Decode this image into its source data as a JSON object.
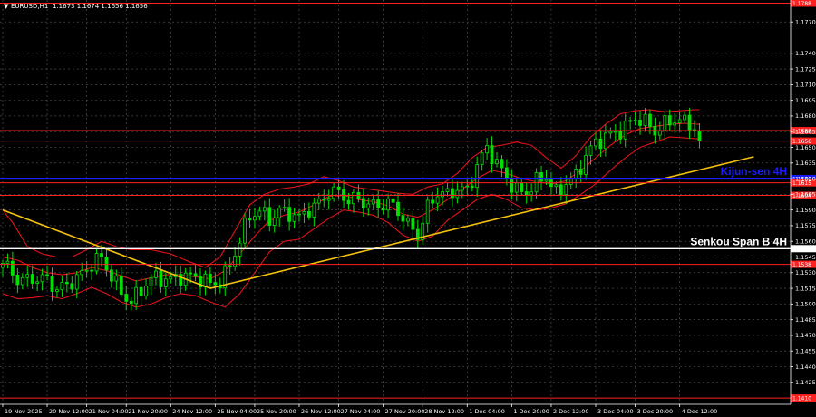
{
  "header": {
    "triangle_glyph": "▼",
    "symbol": "EURUSD,H1",
    "ohlc": "1.1673 1.1674 1.1656 1.1656"
  },
  "chart_data": {
    "type": "candlestick",
    "symbol": "EURUSD",
    "timeframe": "H1",
    "ylim": [
      1.1404,
      1.1791
    ],
    "bars_visible": 240,
    "y_ticks": [
      "1.1770",
      "1.1740",
      "1.1725",
      "1.1710",
      "1.1695",
      "1.1680",
      "1.1665",
      "1.1650",
      "1.1635",
      "1.1620",
      "1.1605",
      "1.1590",
      "1.1575",
      "1.1560",
      "1.1545",
      "1.1530",
      "1.1515",
      "1.1500",
      "1.1485",
      "1.1470",
      "1.1455",
      "1.1440",
      "1.1425"
    ],
    "x_labels": [
      {
        "text": "19 Nov 2025",
        "bar": 0
      },
      {
        "text": "20 Nov 12:00",
        "bar": 9
      },
      {
        "text": "21 Nov 04:00",
        "bar": 17
      },
      {
        "text": "21 Nov 20:00",
        "bar": 25
      },
      {
        "text": "24 Nov 12:00",
        "bar": 34
      },
      {
        "text": "25 Nov 04:00",
        "bar": 43
      },
      {
        "text": "25 Nov 20:00",
        "bar": 51
      },
      {
        "text": "26 Nov 12:00",
        "bar": 60
      },
      {
        "text": "27 Nov 04:00",
        "bar": 68
      },
      {
        "text": "27 Nov 20:00",
        "bar": 77
      },
      {
        "text": "28 Nov 12:00",
        "bar": 85
      },
      {
        "text": "1 Dec 04:00",
        "bar": 94
      },
      {
        "text": "1 Dec 20:00",
        "bar": 103
      },
      {
        "text": "2 Dec 12:00",
        "bar": 111
      },
      {
        "text": "3 Dec 04:00",
        "bar": 120
      },
      {
        "text": "3 Dec 20:00",
        "bar": 128
      },
      {
        "text": "4 Dec 12:00",
        "bar": 137
      }
    ],
    "close_path": [
      [
        0,
        1.1535
      ],
      [
        3,
        1.1525
      ],
      [
        6,
        1.1528
      ],
      [
        9,
        1.152
      ],
      [
        11,
        1.151
      ],
      [
        14,
        1.1525
      ],
      [
        17,
        1.1535
      ],
      [
        20,
        1.154
      ],
      [
        22,
        1.1525
      ],
      [
        24,
        1.1515
      ],
      [
        26,
        1.1505
      ],
      [
        28,
        1.1512
      ],
      [
        30,
        1.152
      ],
      [
        33,
        1.1525
      ],
      [
        36,
        1.153
      ],
      [
        39,
        1.1522
      ],
      [
        42,
        1.1518
      ],
      [
        44,
        1.1525
      ],
      [
        46,
        1.154
      ],
      [
        48,
        1.156
      ],
      [
        50,
        1.158
      ],
      [
        52,
        1.1588
      ],
      [
        54,
        1.1585
      ],
      [
        56,
        1.1592
      ],
      [
        58,
        1.1585
      ],
      [
        60,
        1.1578
      ],
      [
        62,
        1.159
      ],
      [
        64,
        1.16
      ],
      [
        66,
        1.161
      ],
      [
        68,
        1.1605
      ],
      [
        70,
        1.1595
      ],
      [
        72,
        1.16
      ],
      [
        75,
        1.1598
      ],
      [
        78,
        1.1595
      ],
      [
        80,
        1.1585
      ],
      [
        82,
        1.1575
      ],
      [
        84,
        1.157
      ],
      [
        86,
        1.1595
      ],
      [
        88,
        1.1605
      ],
      [
        90,
        1.16
      ],
      [
        92,
        1.161
      ],
      [
        94,
        1.1612
      ],
      [
        96,
        1.1635
      ],
      [
        98,
        1.1648
      ],
      [
        100,
        1.163
      ],
      [
        102,
        1.162
      ],
      [
        104,
        1.1612
      ],
      [
        106,
        1.161
      ],
      [
        108,
        1.1615
      ],
      [
        110,
        1.1618
      ],
      [
        112,
        1.1605
      ],
      [
        114,
        1.162
      ],
      [
        116,
        1.1625
      ],
      [
        118,
        1.164
      ],
      [
        120,
        1.165
      ],
      [
        122,
        1.166
      ],
      [
        124,
        1.1668
      ],
      [
        126,
        1.1672
      ],
      [
        128,
        1.1676
      ],
      [
        130,
        1.167
      ],
      [
        132,
        1.1665
      ],
      [
        134,
        1.1676
      ],
      [
        136,
        1.168
      ],
      [
        138,
        1.1672
      ],
      [
        140,
        1.1665
      ],
      [
        141,
        1.1656
      ]
    ],
    "band_upper": [
      [
        0,
        1.159
      ],
      [
        2,
        1.1578
      ],
      [
        5,
        1.1555
      ],
      [
        8,
        1.1548
      ],
      [
        11,
        1.1545
      ],
      [
        14,
        1.1545
      ],
      [
        17,
        1.1552
      ],
      [
        20,
        1.156
      ],
      [
        23,
        1.1555
      ],
      [
        26,
        1.1552
      ],
      [
        30,
        1.1552
      ],
      [
        34,
        1.1548
      ],
      [
        38,
        1.154
      ],
      [
        41,
        1.1535
      ],
      [
        44,
        1.1545
      ],
      [
        47,
        1.157
      ],
      [
        50,
        1.1595
      ],
      [
        53,
        1.1605
      ],
      [
        56,
        1.161
      ],
      [
        59,
        1.1612
      ],
      [
        62,
        1.1615
      ],
      [
        65,
        1.1622
      ],
      [
        68,
        1.1618
      ],
      [
        71,
        1.1612
      ],
      [
        74,
        1.161
      ],
      [
        77,
        1.1608
      ],
      [
        80,
        1.1606
      ],
      [
        83,
        1.1605
      ],
      [
        86,
        1.1612
      ],
      [
        89,
        1.1615
      ],
      [
        92,
        1.1625
      ],
      [
        95,
        1.164
      ],
      [
        98,
        1.165
      ],
      [
        101,
        1.1652
      ],
      [
        104,
        1.1655
      ],
      [
        107,
        1.1652
      ],
      [
        110,
        1.164
      ],
      [
        113,
        1.163
      ],
      [
        116,
        1.1642
      ],
      [
        119,
        1.166
      ],
      [
        122,
        1.1672
      ],
      [
        125,
        1.1682
      ],
      [
        128,
        1.1685
      ],
      [
        131,
        1.1686
      ],
      [
        134,
        1.1684
      ],
      [
        137,
        1.1685
      ],
      [
        140,
        1.1686
      ],
      [
        141,
        1.1686
      ]
    ],
    "band_middle": [
      [
        0,
        1.1545
      ],
      [
        3,
        1.1542
      ],
      [
        6,
        1.1535
      ],
      [
        9,
        1.153
      ],
      [
        12,
        1.1528
      ],
      [
        15,
        1.153
      ],
      [
        18,
        1.1535
      ],
      [
        21,
        1.1532
      ],
      [
        24,
        1.1527
      ],
      [
        27,
        1.1522
      ],
      [
        30,
        1.1525
      ],
      [
        33,
        1.1528
      ],
      [
        36,
        1.1528
      ],
      [
        39,
        1.1526
      ],
      [
        42,
        1.1524
      ],
      [
        45,
        1.1532
      ],
      [
        48,
        1.1548
      ],
      [
        51,
        1.1565
      ],
      [
        54,
        1.158
      ],
      [
        57,
        1.1585
      ],
      [
        60,
        1.1588
      ],
      [
        63,
        1.1595
      ],
      [
        66,
        1.1603
      ],
      [
        69,
        1.1604
      ],
      [
        72,
        1.16
      ],
      [
        75,
        1.1598
      ],
      [
        78,
        1.1594
      ],
      [
        81,
        1.1586
      ],
      [
        84,
        1.1583
      ],
      [
        87,
        1.159
      ],
      [
        90,
        1.16
      ],
      [
        93,
        1.161
      ],
      [
        96,
        1.162
      ],
      [
        99,
        1.1628
      ],
      [
        102,
        1.1625
      ],
      [
        105,
        1.162
      ],
      [
        108,
        1.1617
      ],
      [
        111,
        1.1615
      ],
      [
        114,
        1.1618
      ],
      [
        117,
        1.1628
      ],
      [
        120,
        1.164
      ],
      [
        123,
        1.1652
      ],
      [
        126,
        1.1662
      ],
      [
        129,
        1.1668
      ],
      [
        132,
        1.167
      ],
      [
        135,
        1.1672
      ],
      [
        138,
        1.1673
      ],
      [
        141,
        1.1672
      ]
    ],
    "band_lower": [
      [
        0,
        1.151
      ],
      [
        3,
        1.1505
      ],
      [
        6,
        1.1506
      ],
      [
        9,
        1.1508
      ],
      [
        12,
        1.1505
      ],
      [
        15,
        1.151
      ],
      [
        18,
        1.1516
      ],
      [
        21,
        1.151
      ],
      [
        24,
        1.1502
      ],
      [
        27,
        1.1497
      ],
      [
        30,
        1.15
      ],
      [
        33,
        1.1506
      ],
      [
        36,
        1.151
      ],
      [
        39,
        1.1508
      ],
      [
        42,
        1.1502
      ],
      [
        45,
        1.1497
      ],
      [
        48,
        1.151
      ],
      [
        51,
        1.153
      ],
      [
        54,
        1.155
      ],
      [
        57,
        1.156
      ],
      [
        60,
        1.1562
      ],
      [
        63,
        1.1572
      ],
      [
        66,
        1.1582
      ],
      [
        69,
        1.159
      ],
      [
        72,
        1.1588
      ],
      [
        75,
        1.1585
      ],
      [
        78,
        1.1578
      ],
      [
        81,
        1.1566
      ],
      [
        84,
        1.156
      ],
      [
        87,
        1.1565
      ],
      [
        90,
        1.158
      ],
      [
        93,
        1.159
      ],
      [
        96,
        1.16
      ],
      [
        99,
        1.1605
      ],
      [
        102,
        1.16
      ],
      [
        105,
        1.1592
      ],
      [
        108,
        1.159
      ],
      [
        111,
        1.1592
      ],
      [
        114,
        1.1596
      ],
      [
        117,
        1.1605
      ],
      [
        120,
        1.1615
      ],
      [
        123,
        1.1628
      ],
      [
        126,
        1.164
      ],
      [
        129,
        1.165
      ],
      [
        132,
        1.1655
      ],
      [
        135,
        1.166
      ],
      [
        138,
        1.1659
      ],
      [
        141,
        1.1658
      ]
    ],
    "trendlines": [
      {
        "from": [
          0,
          1.159
        ],
        "to": [
          42,
          1.1515
        ]
      },
      {
        "from": [
          42,
          1.1515
        ],
        "to": [
          152,
          1.1641
        ]
      }
    ],
    "levels": [
      {
        "price": 1.1788,
        "color": "#ff2020",
        "label": "1.1788",
        "kind": "support-resistance"
      },
      {
        "price": 1.1666,
        "color": "#ff2020",
        "label": "1.1666",
        "kind": "support-resistance"
      },
      {
        "price": 1.1656,
        "color": "#ff2020",
        "label": "1.1656",
        "kind": "support-resistance"
      },
      {
        "price": 1.162,
        "color": "#1a1aff",
        "label": "1.1620",
        "kind": "kijun"
      },
      {
        "price": 1.1616,
        "color": "#ff2020",
        "label": "1.1615",
        "kind": "support-resistance"
      },
      {
        "price": 1.1604,
        "color": "#ff2020",
        "label": "1.1604",
        "kind": "support-resistance"
      },
      {
        "price": 1.1553,
        "color": "#ffffff",
        "label": "1.1553",
        "kind": "senkou"
      },
      {
        "price": 1.1538,
        "color": "#ff2020",
        "label": "1.1538",
        "kind": "support-resistance"
      },
      {
        "price": 1.141,
        "color": "#ff2020",
        "label": "1.1410",
        "kind": "support-resistance"
      }
    ],
    "annotations": [
      {
        "text": "Kijun-sen 4H",
        "color": "#1a1aff",
        "price": 1.162
      },
      {
        "text": "Senkou Span B 4H",
        "color": "#ffffff",
        "price": 1.1553
      }
    ],
    "colors": {
      "background": "#000000",
      "grid": "#5a5a5a",
      "candle_up": "#00e000",
      "candle_down": "#00e000",
      "bands": "#e0131b",
      "trendline": "#f4c20d"
    },
    "grid": true
  }
}
